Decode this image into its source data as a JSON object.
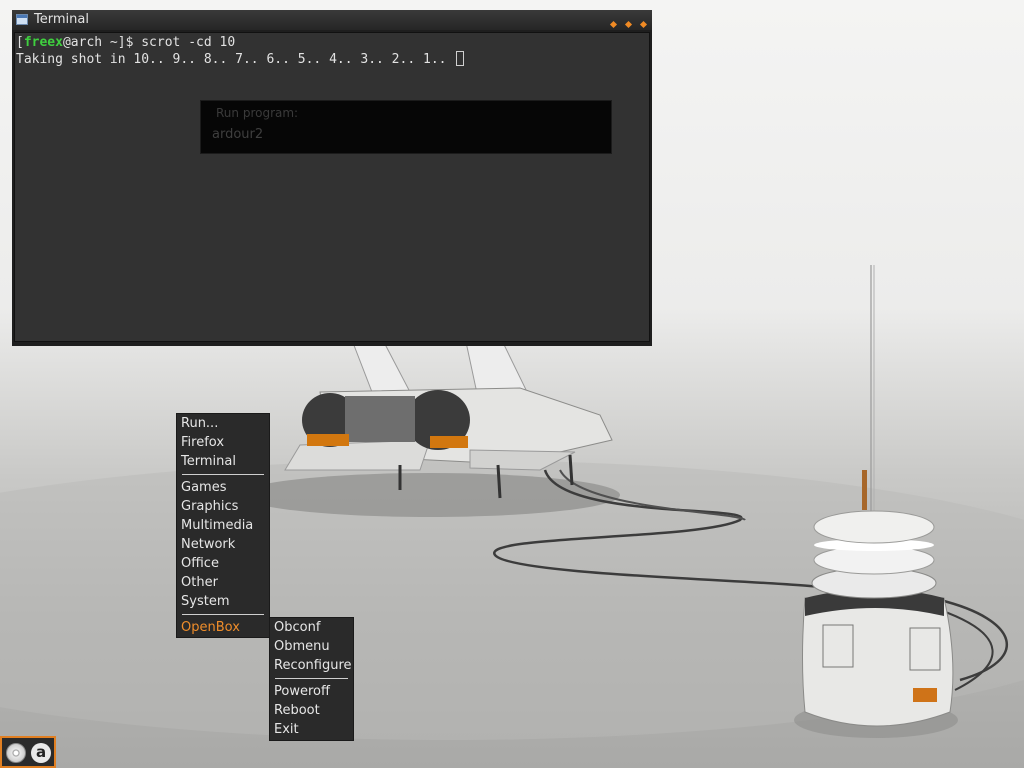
{
  "terminal": {
    "title": "Terminal",
    "prompt_open": "[",
    "user": "freex",
    "prompt_rest": "@arch ~]$ scrot -cd 10",
    "output_line": "Taking shot in 10.. 9.. 8.. 7.. 6.. 5.. 4.. 3.. 2.. 1.. "
  },
  "run_dialog": {
    "label": "Run program:",
    "value": "ardour2"
  },
  "root_menu": {
    "items": [
      "Run...",
      "Firefox",
      "Terminal",
      "Games",
      "Graphics",
      "Multimedia",
      "Network",
      "Office",
      "Other",
      "System",
      "OpenBox"
    ]
  },
  "openbox_menu": {
    "items": [
      "Obconf",
      "Obmenu",
      "Reconfigure",
      "Poweroff",
      "Reboot",
      "Exit"
    ]
  },
  "dock": {
    "icons": [
      "disc-icon",
      "arch-linux-icon"
    ]
  },
  "colors": {
    "accent": "#ef8d2a",
    "menu_bg": "#2a2a2a",
    "terminal_bg": "#323232",
    "user_green": "#3fd03f"
  }
}
